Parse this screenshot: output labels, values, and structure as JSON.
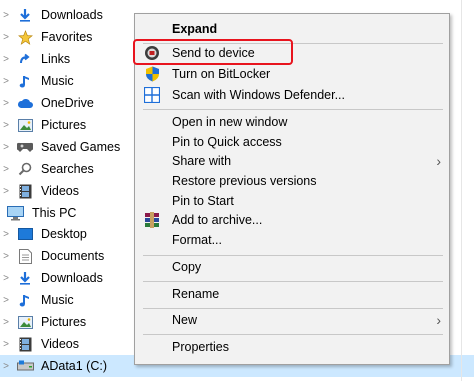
{
  "tree": {
    "items": [
      {
        "label": "Downloads",
        "icon": "download-arrow-icon"
      },
      {
        "label": "Favorites",
        "icon": "star-icon"
      },
      {
        "label": "Links",
        "icon": "link-arrow-icon"
      },
      {
        "label": "Music",
        "icon": "music-note-icon"
      },
      {
        "label": "OneDrive",
        "icon": "cloud-icon"
      },
      {
        "label": "Pictures",
        "icon": "picture-icon"
      },
      {
        "label": "Saved Games",
        "icon": "game-controller-icon"
      },
      {
        "label": "Searches",
        "icon": "magnifier-icon"
      },
      {
        "label": "Videos",
        "icon": "film-icon"
      },
      {
        "label": "This PC",
        "icon": "computer-icon"
      },
      {
        "label": "Desktop",
        "icon": "desktop-icon"
      },
      {
        "label": "Documents",
        "icon": "document-icon"
      },
      {
        "label": "Downloads",
        "icon": "download-arrow-icon"
      },
      {
        "label": "Music",
        "icon": "music-note-icon"
      },
      {
        "label": "Pictures",
        "icon": "picture-icon"
      },
      {
        "label": "Videos",
        "icon": "film-icon"
      },
      {
        "label": "AData1 (C:)",
        "icon": "drive-icon"
      }
    ]
  },
  "menu": {
    "expand": "Expand",
    "send_to_device": "Send to device",
    "bitlocker": "Turn on BitLocker",
    "defender": "Scan with Windows Defender...",
    "open_new_window": "Open in new window",
    "pin_quick": "Pin to Quick access",
    "share_with": "Share with",
    "restore": "Restore previous versions",
    "pin_start": "Pin to Start",
    "add_archive": "Add to archive...",
    "format": "Format...",
    "copy": "Copy",
    "rename": "Rename",
    "new": "New",
    "properties": "Properties"
  },
  "colors": {
    "selection": "#cce8ff",
    "annotation": "#e8141e",
    "menu_bg": "#f2f2f2"
  }
}
